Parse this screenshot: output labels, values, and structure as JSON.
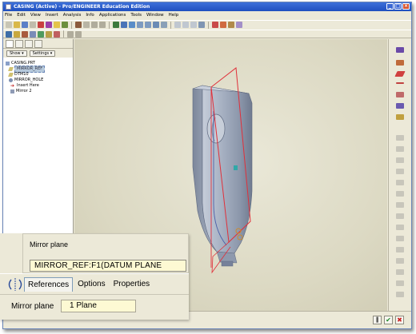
{
  "window": {
    "title": "CASING (Active) - Pro/ENGINEER Education Edition"
  },
  "menubar": {
    "items": [
      "File",
      "Edit",
      "View",
      "Insert",
      "Analysis",
      "Info",
      "Applications",
      "Tools",
      "Window",
      "Help"
    ]
  },
  "navigator": {
    "show_label": "Show ▾",
    "settings_label": "Settings ▾",
    "tree": [
      {
        "label": "CASING.PRT",
        "icon": "part-icon",
        "selected": false
      },
      {
        "label": "MIRROR_REF",
        "icon": "datum-plane-icon",
        "selected": true
      },
      {
        "label": "DTM10",
        "icon": "datum-plane-icon",
        "selected": false
      },
      {
        "label": "MIRROR_HOLE",
        "icon": "hole-feature-icon",
        "selected": false
      },
      {
        "label": "Insert Here",
        "icon": "insert-arrow-icon",
        "selected": false
      },
      {
        "label": "Mirror 2",
        "icon": "mirror-feature-icon",
        "selected": false
      }
    ]
  },
  "dashboard": {
    "panel": {
      "title": "Mirror plane",
      "value": "MIRROR_REF:F1(DATUM PLANE"
    },
    "tabs": {
      "references": "References",
      "options": "Options",
      "properties": "Properties"
    },
    "main": {
      "label": "Mirror plane",
      "value": "1 Plane"
    }
  },
  "colors": {
    "titlebar": "#2458c8",
    "viewport_bg": "#dcd9c3",
    "model_body": "#9eaabf",
    "datum_plane": "#e0303a",
    "field_bg": "#fdf9d3"
  },
  "icons": {
    "ok": "✔",
    "cancel": "✖",
    "pause": "‖"
  }
}
